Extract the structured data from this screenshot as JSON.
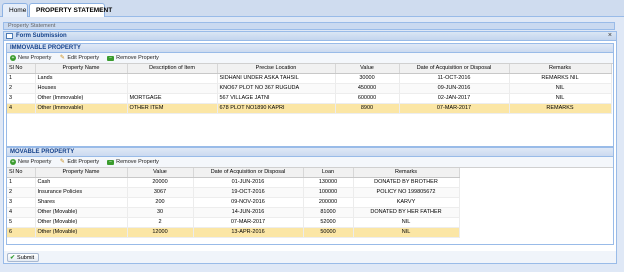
{
  "tabs": [
    {
      "label": "Home"
    },
    {
      "label": "PROPERTY STATEMENT",
      "close": "×"
    }
  ],
  "background_title": "Property Statement",
  "dialog": {
    "title": "Form Submission",
    "close": "×"
  },
  "immovable": {
    "title": "IMMOVABLE PROPERTY",
    "toolbar": {
      "new": "New Property",
      "edit": "Edit Property",
      "remove": "Remove Property"
    },
    "columns": [
      "Sl No",
      "Property Name",
      "Description of Item",
      "Precise Location",
      "Value",
      "Date of Acquisition or Disposal",
      "Remarks"
    ],
    "rows": [
      [
        "1",
        "Lands",
        "",
        "SIDHANI UNDER ASKA TAHSIL",
        "30000",
        "11-OCT-2016",
        "REMARKS NIL"
      ],
      [
        "2",
        "Houses",
        "",
        "KNO67 PLOT NO 367 RUGUDA",
        "450000",
        "09-JUN-2016",
        "NIL"
      ],
      [
        "3",
        "Other (Immovable)",
        "MORTGAGE",
        "567 VILLAGE JATNI",
        "600000",
        "02-JAN-2017",
        "NIL"
      ],
      [
        "4",
        "Other (Immovable)",
        "OTHER ITEM",
        "678 PLOT NO1890 KAPRI",
        "8900",
        "07-MAR-2017",
        "REMARKS"
      ]
    ],
    "selected_row": 3
  },
  "movable": {
    "title": "MOVABLE PROPERTY",
    "toolbar": {
      "new": "New Property",
      "edit": "Edit Property",
      "remove": "Remove Property"
    },
    "columns": [
      "Sl No",
      "Property Name",
      "Value",
      "Date of Acquisition or Disposal",
      "Loan",
      "Remarks"
    ],
    "rows": [
      [
        "1",
        "Cash",
        "20000",
        "01-JUN-2016",
        "130000",
        "DONATED BY BROTHER"
      ],
      [
        "2",
        "Insurance Policies",
        "3067",
        "19-OCT-2016",
        "100000",
        "POLICY NO 199805672"
      ],
      [
        "3",
        "Shares",
        "200",
        "09-NOV-2016",
        "200000",
        "KARVY"
      ],
      [
        "4",
        "Other (Movable)",
        "30",
        "14-JUN-2016",
        "81000",
        "DONATED BY HER FATHER"
      ],
      [
        "5",
        "Other (Movable)",
        "2",
        "07-MAR-2017",
        "52000",
        "NIL"
      ],
      [
        "6",
        "Other (Movable)",
        "12000",
        "13-APR-2016",
        "50000",
        "NIL"
      ]
    ],
    "selected_row": 5
  },
  "footer": {
    "submit": "Submit"
  }
}
